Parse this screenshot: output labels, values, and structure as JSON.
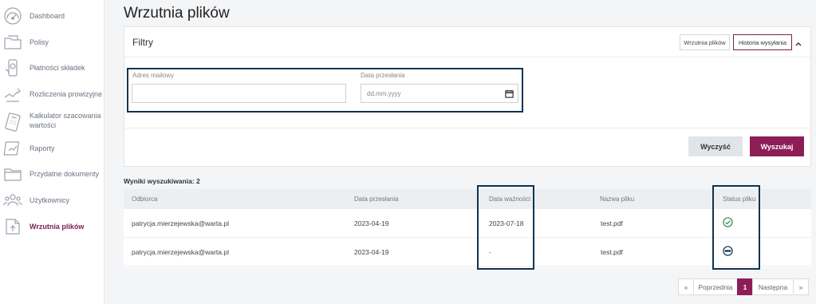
{
  "sidebar": {
    "items": [
      {
        "label": "Dashboard",
        "icon": "dashboard-gauge-icon"
      },
      {
        "label": "Polisy",
        "icon": "policy-folder-icon"
      },
      {
        "label": "Płatności składek",
        "icon": "payment-icon"
      },
      {
        "label": "Rozliczenia prowizyjne",
        "icon": "commission-icon"
      },
      {
        "label": "Kalkulator szacowania wartości",
        "icon": "calculator-icon"
      },
      {
        "label": "Raporty",
        "icon": "reports-icon"
      },
      {
        "label": "Przydatne dokumenty",
        "icon": "documents-folder-icon"
      },
      {
        "label": "Użytkownicy",
        "icon": "users-icon"
      },
      {
        "label": "Wrzutnia plików",
        "icon": "file-upload-icon",
        "active": true
      }
    ]
  },
  "page": {
    "title": "Wrzutnia plików"
  },
  "filters": {
    "title": "Filtry",
    "tab_upload": "Wrzutnia plików",
    "tab_history": "Historia wysyłania",
    "email_label": "Adres mailowy",
    "email_value": "",
    "date_label": "Data przesłania",
    "date_placeholder": "dd.mm.yyyy",
    "clear_label": "Wyczyść",
    "search_label": "Wyszukaj"
  },
  "results": {
    "count_text": "Wyniki wyszukiwania: 2",
    "headers": {
      "recipient": "Odbiorca",
      "sent_date": "Data przesłania",
      "expiry_date": "Data ważności",
      "file_name": "Nazwa pliku",
      "file_status": "Status pliku"
    },
    "rows": [
      {
        "recipient": "patrycja.mierzejewska@warta.pl",
        "sent_date": "2023-04-19",
        "expiry_date": "2023-07-18",
        "file_name": "test.pdf",
        "status_icon": "check-circle-icon"
      },
      {
        "recipient": "patrycja.mierzejewska@warta.pl",
        "sent_date": "2023-04-19",
        "expiry_date": "-",
        "file_name": "test.pdf",
        "status_icon": "pending-dots-icon"
      }
    ]
  },
  "pagination": {
    "first": "«",
    "prev": "Poprzednia",
    "current": "1",
    "next": "Następna",
    "last": "»"
  },
  "colors": {
    "accent": "#8d1d57",
    "highlight_border": "#0f3350",
    "status_green": "#2f8a4a",
    "status_navy": "#0f3350"
  }
}
